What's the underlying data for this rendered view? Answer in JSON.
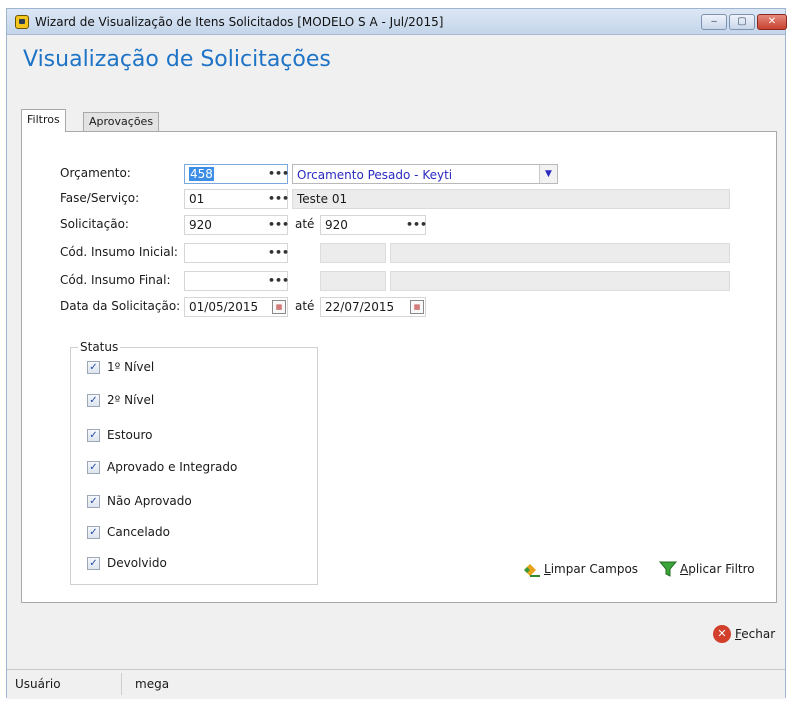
{
  "window": {
    "title": "Wizard de Visualização de Itens Solicitados [MODELO S A - Jul/2015]",
    "controls": {
      "minimize": "‒",
      "maximize": "▢",
      "close": "✕"
    }
  },
  "heading": "Visualização de Solicitações",
  "tabs": [
    "Filtros",
    "Aprovações"
  ],
  "form": {
    "orcamento": {
      "label": "Orçamento:",
      "code": "458",
      "name": "Orcamento Pesado - Keyti"
    },
    "fase": {
      "label": "Fase/Serviço:",
      "code": "01",
      "desc": "Teste 01"
    },
    "solicitacao": {
      "label": "Solicitação:",
      "from": "920",
      "ate": "até",
      "to": "920"
    },
    "insumo_inicial": {
      "label": "Cód. Insumo Inicial:",
      "code": ""
    },
    "insumo_final": {
      "label": "Cód. Insumo Final:",
      "code": ""
    },
    "data": {
      "label": "Data da Solicitação:",
      "from": "01/05/2015",
      "ate": "até",
      "to": "22/07/2015"
    },
    "ellipsis": "•••"
  },
  "status": {
    "legend": "Status",
    "items": [
      {
        "label": "1º Nível",
        "checked": true
      },
      {
        "label": "2º Nível",
        "checked": true
      },
      {
        "label": "Estouro",
        "checked": true
      },
      {
        "label": "Aprovado e Integrado",
        "checked": true
      },
      {
        "label": "Não Aprovado",
        "checked": true
      },
      {
        "label": "Cancelado",
        "checked": true
      },
      {
        "label": "Devolvido",
        "checked": true
      }
    ]
  },
  "actions": {
    "limpar": {
      "accel": "L",
      "rest": "impar Campos"
    },
    "aplicar": {
      "accel": "A",
      "rest": "plicar Filtro"
    },
    "fechar": {
      "accel": "F",
      "rest": "echar"
    }
  },
  "statusbar": {
    "user_label": "Usuário",
    "user_value": "mega"
  },
  "colors": {
    "heading": "#1d73c6",
    "link_text": "#2a2ac0",
    "close": "#d2402b"
  }
}
